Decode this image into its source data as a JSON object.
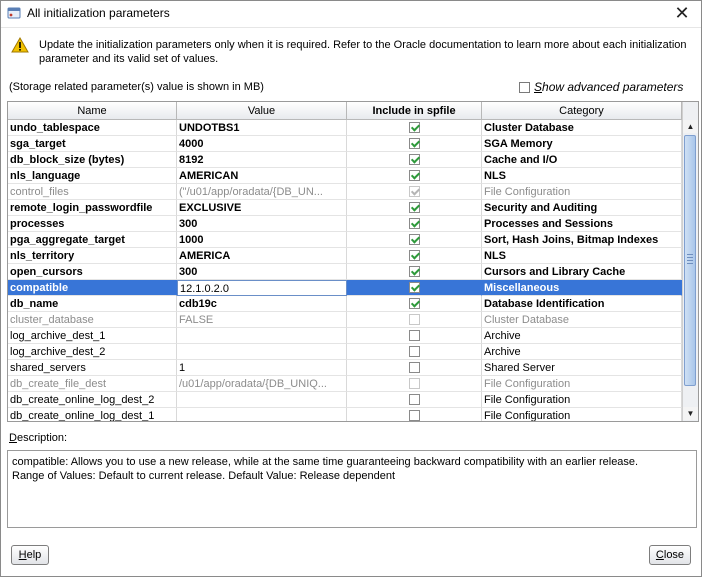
{
  "window": {
    "title": "All initialization parameters"
  },
  "warning": "Update the initialization parameters only when it is required. Refer to the Oracle documentation to learn more about each initialization parameter and its valid set of values.",
  "storage_note": "(Storage related parameter(s) value is shown in MB)",
  "show_advanced": {
    "label_u": "S",
    "label_rest": "how advanced parameters",
    "checked": false
  },
  "table": {
    "headers": {
      "name": "Name",
      "value": "Value",
      "include": "Include in spfile",
      "category": "Category"
    },
    "rows": [
      {
        "name": "undo_tablespace",
        "value": "UNDOTBS1",
        "include": true,
        "category": "Cluster Database",
        "style": "bold"
      },
      {
        "name": "sga_target",
        "value": "4000",
        "include": true,
        "category": "SGA Memory",
        "style": "bold"
      },
      {
        "name": "db_block_size (bytes)",
        "value": "8192",
        "include": true,
        "category": "Cache and I/O",
        "style": "bold"
      },
      {
        "name": "nls_language",
        "value": "AMERICAN",
        "include": true,
        "category": "NLS",
        "style": "bold"
      },
      {
        "name": "control_files",
        "value": "(\"/u01/app/oradata/{DB_UN...",
        "include": true,
        "category": "File Configuration",
        "style": "disabled"
      },
      {
        "name": "remote_login_passwordfile",
        "value": "EXCLUSIVE",
        "include": true,
        "category": "Security and Auditing",
        "style": "bold"
      },
      {
        "name": "processes",
        "value": "300",
        "include": true,
        "category": "Processes and Sessions",
        "style": "bold"
      },
      {
        "name": "pga_aggregate_target",
        "value": "1000",
        "include": true,
        "category": "Sort, Hash Joins, Bitmap Indexes",
        "style": "bold"
      },
      {
        "name": "nls_territory",
        "value": "AMERICA",
        "include": true,
        "category": "NLS",
        "style": "bold"
      },
      {
        "name": "open_cursors",
        "value": "300",
        "include": true,
        "category": "Cursors and Library Cache",
        "style": "bold"
      },
      {
        "name": "compatible",
        "value": "12.1.0.2.0",
        "include": true,
        "category": "Miscellaneous",
        "style": "selected"
      },
      {
        "name": "db_name",
        "value": "cdb19c",
        "include": true,
        "category": "Database Identification",
        "style": "bold"
      },
      {
        "name": "cluster_database",
        "value": "FALSE",
        "include": false,
        "category": "Cluster Database",
        "style": "disabled"
      },
      {
        "name": "log_archive_dest_1",
        "value": "",
        "include": false,
        "category": "Archive",
        "style": "normal"
      },
      {
        "name": "log_archive_dest_2",
        "value": "",
        "include": false,
        "category": "Archive",
        "style": "normal"
      },
      {
        "name": "shared_servers",
        "value": "1",
        "include": false,
        "category": "Shared Server",
        "style": "normal"
      },
      {
        "name": "db_create_file_dest",
        "value": "/u01/app/oradata/{DB_UNIQ...",
        "include": false,
        "category": "File Configuration",
        "style": "disabled"
      },
      {
        "name": "db_create_online_log_dest_2",
        "value": "",
        "include": false,
        "category": "File Configuration",
        "style": "normal"
      },
      {
        "name": "db_create_online_log_dest_1",
        "value": "",
        "include": false,
        "category": "File Configuration",
        "style": "normal"
      }
    ]
  },
  "description": {
    "label_u": "D",
    "label_rest": "escription:",
    "line1": "compatible: Allows you to use a new release, while at the same time guaranteeing backward compatibility with an earlier release.",
    "line2": "Range of Values: Default to current release. Default Value: Release dependent"
  },
  "buttons": {
    "help_u": "H",
    "help_rest": "elp",
    "close_u": "C",
    "close_rest": "lose"
  },
  "icons": {
    "app": "oracle-app-icon",
    "warning": "warning-triangle-icon",
    "close": "close-icon"
  },
  "colors": {
    "selection": "#3875d7",
    "check": "#2e9a3b",
    "warning": "#f2c200"
  }
}
